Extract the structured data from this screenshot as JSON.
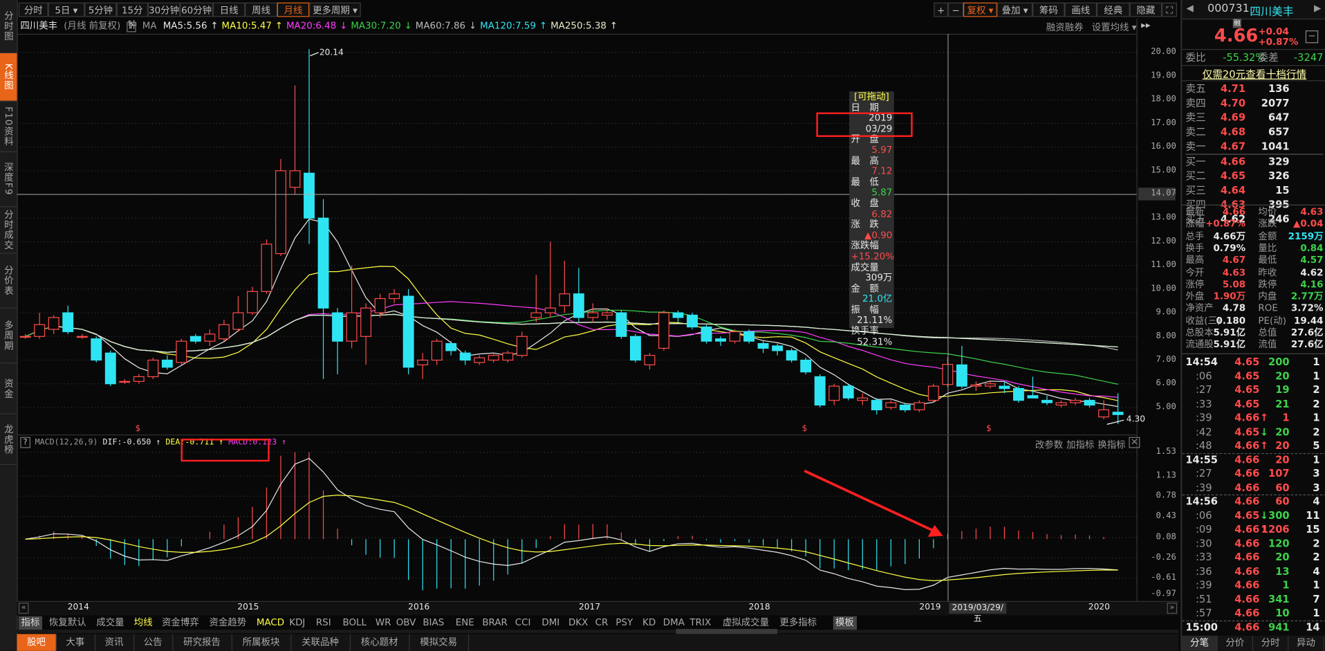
{
  "sidebar": {
    "items": [
      {
        "label": "分时图"
      },
      {
        "label": "K线图",
        "active": true
      },
      {
        "label": "F10资料"
      },
      {
        "label": "深度F9"
      },
      {
        "label": "分时成交"
      },
      {
        "label": "分价表"
      },
      {
        "label": "多周期"
      },
      {
        "label": "资金"
      },
      {
        "label": "龙虎榜"
      }
    ]
  },
  "toolbar": {
    "periods": [
      "分时",
      "5日 ▾",
      "5分钟",
      "15分钟",
      "30分钟",
      "60分钟",
      "日线",
      "周线",
      "月线",
      "更多周期 ▾"
    ],
    "active_period": "月线",
    "right": [
      "+",
      "−",
      "复权 ▾",
      "叠加 ▾",
      "筹码",
      "画线",
      "经典",
      "隐藏 ▸▸",
      "⛶"
    ],
    "active_right": "复权 ▾"
  },
  "infobar": {
    "name": "四川美丰",
    "mode": "(月线 前复权)",
    "help": "?",
    "ma_label": "MA",
    "ma": [
      {
        "text": "MA5:5.56",
        "arrow": "↑",
        "color": "#e8e8e8"
      },
      {
        "text": "MA10:5.47",
        "arrow": "↑",
        "color": "#ffff44"
      },
      {
        "text": "MA20:6.48",
        "arrow": "↓",
        "color": "#ff3cff"
      },
      {
        "text": "MA30:7.20",
        "arrow": "↓",
        "color": "#3cd24a"
      },
      {
        "text": "MA60:7.86",
        "arrow": "↓",
        "color": "#bbbbbb"
      },
      {
        "text": "MA120:7.59",
        "arrow": "↑",
        "color": "#2fe4f2"
      },
      {
        "text": "MA250:5.38",
        "arrow": "↑",
        "color": "#e8e8c8"
      }
    ],
    "margin_trading": "融资融券",
    "set_ma": "设置均线 ▾"
  },
  "chart_data": {
    "type": "candlestick",
    "price_axis": [
      "20.00",
      "19.00",
      "18.00",
      "17.00",
      "16.00",
      "15.00",
      "14.00",
      "13.00",
      "12.00",
      "11.00",
      "10.00",
      "9.00",
      "8.00",
      "7.00",
      "6.00",
      "5.00"
    ],
    "ylim": [
      4.3,
      20.14
    ],
    "crosshair_price": "14.07",
    "max_label": "20.14",
    "min_label": "4.30",
    "dividend_marker": "$",
    "candles": [
      [
        8.0,
        8.1,
        7.9,
        8.0
      ],
      [
        8.0,
        9.0,
        7.9,
        8.5
      ],
      [
        8.3,
        8.9,
        8.1,
        8.8
      ],
      [
        9.0,
        9.3,
        8.1,
        8.2
      ],
      [
        8.0,
        8.1,
        7.9,
        8.0
      ],
      [
        7.9,
        8.0,
        6.9,
        7.0
      ],
      [
        7.3,
        7.4,
        5.9,
        6.0
      ],
      [
        6.1,
        6.2,
        6.0,
        6.1
      ],
      [
        6.1,
        6.4,
        6.0,
        6.3
      ],
      [
        6.3,
        7.1,
        6.2,
        7.0
      ],
      [
        7.0,
        7.2,
        6.6,
        6.7
      ],
      [
        6.9,
        7.9,
        6.8,
        7.8
      ],
      [
        8.0,
        8.1,
        7.7,
        7.8
      ],
      [
        7.8,
        8.3,
        7.6,
        8.1
      ],
      [
        7.9,
        8.7,
        7.8,
        8.5
      ],
      [
        8.3,
        9.7,
        8.2,
        9.0
      ],
      [
        9.0,
        10.1,
        8.9,
        9.9
      ],
      [
        9.9,
        12.1,
        9.8,
        11.9
      ],
      [
        11.5,
        15.5,
        11.4,
        15.0
      ],
      [
        14.3,
        18.6,
        14.0,
        15.0
      ],
      [
        14.9,
        20.14,
        11.9,
        13.0
      ],
      [
        13.0,
        13.8,
        6.2,
        9.2
      ],
      [
        9.0,
        9.2,
        6.4,
        7.8
      ],
      [
        7.8,
        11.0,
        7.5,
        9.0
      ],
      [
        8.0,
        9.4,
        6.8,
        9.2
      ],
      [
        9.0,
        9.8,
        8.8,
        9.6
      ],
      [
        9.6,
        10.0,
        9.4,
        9.8
      ],
      [
        9.7,
        10.0,
        6.4,
        6.7
      ],
      [
        6.8,
        7.3,
        6.2,
        7.0
      ],
      [
        7.0,
        7.9,
        6.8,
        7.8
      ],
      [
        7.7,
        7.8,
        7.2,
        7.4
      ],
      [
        7.3,
        7.4,
        6.8,
        7.0
      ],
      [
        6.9,
        7.2,
        6.8,
        7.1
      ],
      [
        7.0,
        7.3,
        6.9,
        7.2
      ],
      [
        7.0,
        7.4,
        6.9,
        7.3
      ],
      [
        7.2,
        8.2,
        7.1,
        8.0
      ],
      [
        8.8,
        10.6,
        8.6,
        9.0
      ],
      [
        9.0,
        12.0,
        8.8,
        9.2
      ],
      [
        9.3,
        11.2,
        9.0,
        9.8
      ],
      [
        9.8,
        10.9,
        8.6,
        8.8
      ],
      [
        8.8,
        9.4,
        8.6,
        9.0
      ],
      [
        8.9,
        9.2,
        8.7,
        9.0
      ],
      [
        9.0,
        9.1,
        7.9,
        8.0
      ],
      [
        8.0,
        8.1,
        6.9,
        7.0
      ],
      [
        6.8,
        7.3,
        6.6,
        7.2
      ],
      [
        7.5,
        9.1,
        7.4,
        9.0
      ],
      [
        9.0,
        9.1,
        8.6,
        8.8
      ],
      [
        8.9,
        9.0,
        8.3,
        8.4
      ],
      [
        8.4,
        8.5,
        7.7,
        7.8
      ],
      [
        7.9,
        8.0,
        7.6,
        7.8
      ],
      [
        7.8,
        8.3,
        7.7,
        8.2
      ],
      [
        8.2,
        8.3,
        7.7,
        7.8
      ],
      [
        7.7,
        7.8,
        7.3,
        7.5
      ],
      [
        7.6,
        7.7,
        7.2,
        7.4
      ],
      [
        7.4,
        7.5,
        6.9,
        7.0
      ],
      [
        7.0,
        7.1,
        6.4,
        6.5
      ],
      [
        6.3,
        6.4,
        5.0,
        5.1
      ],
      [
        5.3,
        6.0,
        5.1,
        5.9
      ],
      [
        5.9,
        6.0,
        5.3,
        5.4
      ],
      [
        5.3,
        5.6,
        5.1,
        5.4
      ],
      [
        5.3,
        5.4,
        4.7,
        4.9
      ],
      [
        5.0,
        5.3,
        4.9,
        5.2
      ],
      [
        5.1,
        5.2,
        4.8,
        4.9
      ],
      [
        4.9,
        5.3,
        4.8,
        5.2
      ],
      [
        5.3,
        6.0,
        5.2,
        5.9
      ],
      [
        5.97,
        7.12,
        5.87,
        6.82
      ],
      [
        6.8,
        7.6,
        5.8,
        5.9
      ],
      [
        5.9,
        6.1,
        5.7,
        5.95
      ],
      [
        5.9,
        6.1,
        5.8,
        6.0
      ],
      [
        5.9,
        6.1,
        5.6,
        5.8
      ],
      [
        5.8,
        5.9,
        5.2,
        5.3
      ],
      [
        5.5,
        6.3,
        5.4,
        5.4
      ],
      [
        5.3,
        5.5,
        5.1,
        5.2
      ],
      [
        5.1,
        5.3,
        5.0,
        5.2
      ],
      [
        5.2,
        5.4,
        5.1,
        5.3
      ],
      [
        5.3,
        5.4,
        5.0,
        5.1
      ],
      [
        4.6,
        5.3,
        4.5,
        4.9
      ],
      [
        4.8,
        5.6,
        4.3,
        4.7
      ]
    ],
    "x_ticks": [
      "2014",
      "2015",
      "2016",
      "2017",
      "2018",
      "2019",
      "2020"
    ],
    "crosshair_date": "2019/03/29/五"
  },
  "tooltip": {
    "drag": "[可拖动]",
    "rows": [
      {
        "label": "日　期",
        "value": "2019\n03/29",
        "color": "#e8e8e8"
      },
      {
        "label": "开　盘",
        "value": "5.97",
        "color": "#ff4b4b"
      },
      {
        "label": "最　高",
        "value": "7.12",
        "color": "#ff4b4b"
      },
      {
        "label": "最　低",
        "value": "5.87",
        "color": "#3cd24a"
      },
      {
        "label": "收　盘",
        "value": "6.82",
        "color": "#ff4b4b"
      },
      {
        "label": "涨　跌",
        "value": "▲0.90",
        "color": "#ff4b4b"
      },
      {
        "label": "涨跌幅",
        "value": "+15.20%",
        "color": "#ff4b4b"
      },
      {
        "label": "成交量",
        "value": "309万",
        "color": "#e8e8e8"
      },
      {
        "label": "金　额",
        "value": "21.0亿",
        "color": "#2fe4f2"
      },
      {
        "label": "振　幅",
        "value": "21.11%",
        "color": "#e8e8e8"
      },
      {
        "label": "换手率",
        "value": "52.31%",
        "color": "#e8e8e8"
      }
    ]
  },
  "macd": {
    "help": "?",
    "name": "MACD(12,26,9)",
    "dif": "DIF:-0.650 ↑",
    "dea": "DEA:-0.711 ↑",
    "macd": "MACD:0.123 ↑",
    "actions": [
      "改参数",
      "加指标",
      "换指标"
    ],
    "close": "×",
    "axis": [
      "1.53",
      "1.13",
      "0.78",
      "0.43",
      "0.08",
      "-0.26",
      "-0.61",
      "-0.97"
    ],
    "ylim": [
      -0.97,
      1.53
    ]
  },
  "indicators": {
    "items": [
      "指标",
      "恢复默认",
      "成交量",
      "均线",
      "资金博弈",
      "资金趋势",
      "MACD",
      "KDJ",
      "RSI",
      "BOLL",
      "WR",
      "OBV",
      "BIAS",
      "ENE",
      "BRAR",
      "CCI",
      "DMI",
      "DKX",
      "CR",
      "PSY",
      "KD",
      "DMA",
      "TRIX",
      "虚拟成交量",
      "更多指标",
      "模板"
    ],
    "highlight": [
      "均线",
      "MACD"
    ]
  },
  "bottom_tabs": [
    "股吧",
    "大事",
    "资讯",
    "公告",
    "研究报告",
    "所属板块",
    "关联品种",
    "核心题材",
    "模拟交易"
  ],
  "quote": {
    "code": "000731",
    "name": "四川美丰",
    "badge": "融",
    "price": "4.66",
    "change": "+0.04",
    "pct": "+0.87%",
    "weibi_label": "委比",
    "weibi": "-55.32%",
    "weicha_label": "委差",
    "weicha": "-3247",
    "promo": "仅需20元查看十档行情",
    "asks": [
      {
        "label": "卖五",
        "price": "4.71",
        "vol": "136"
      },
      {
        "label": "卖四",
        "price": "4.70",
        "vol": "2077"
      },
      {
        "label": "卖三",
        "price": "4.69",
        "vol": "647"
      },
      {
        "label": "卖二",
        "price": "4.68",
        "vol": "657"
      },
      {
        "label": "卖一",
        "price": "4.67",
        "vol": "1041"
      }
    ],
    "bids": [
      {
        "label": "买一",
        "price": "4.66",
        "vol": "329",
        "color": "#ff4b4b"
      },
      {
        "label": "买二",
        "price": "4.65",
        "vol": "326",
        "color": "#ff4b4b"
      },
      {
        "label": "买三",
        "price": "4.64",
        "vol": "15",
        "color": "#ff4b4b"
      },
      {
        "label": "买四",
        "price": "4.63",
        "vol": "395",
        "color": "#ff4b4b"
      },
      {
        "label": "买五",
        "price": "4.62",
        "vol": "246",
        "color": "#e8e8e8"
      }
    ],
    "stats": [
      [
        "最新",
        "4.66",
        "#ff4b4b",
        "均价",
        "4.63",
        "#ff4b4b"
      ],
      [
        "涨幅",
        "+0.87%",
        "#ff4b4b",
        "涨跌",
        "▲0.04",
        "#ff4b4b"
      ],
      [
        "总手",
        "4.66万",
        "#e8e8e8",
        "金额",
        "2159万",
        "#2fe4f2"
      ],
      [
        "换手",
        "0.79%",
        "#e8e8e8",
        "量比",
        "0.84",
        "#3cd24a"
      ],
      [
        "最高",
        "4.67",
        "#ff4b4b",
        "最低",
        "4.57",
        "#3cd24a"
      ],
      [
        "今开",
        "4.63",
        "#ff4b4b",
        "昨收",
        "4.62",
        "#e8e8e8"
      ],
      [
        "涨停",
        "5.08",
        "#ff4b4b",
        "跌停",
        "4.16",
        "#3cd24a"
      ],
      [
        "外盘",
        "1.90万",
        "#ff4b4b",
        "内盘",
        "2.77万",
        "#3cd24a"
      ],
      [
        "净资产",
        "4.78",
        "#e8e8e8",
        "ROE",
        "3.72%",
        "#e8e8e8"
      ],
      [
        "收益(三)",
        "0.180",
        "#e8e8e8",
        "PE(动)",
        "19.44",
        "#e8e8e8"
      ],
      [
        "总股本",
        "5.91亿",
        "#e8e8e8",
        "总值",
        "27.6亿",
        "#e8e8e8"
      ],
      [
        "流通股",
        "5.91亿",
        "#e8e8e8",
        "流值",
        "27.6亿",
        "#e8e8e8"
      ]
    ],
    "ticks": [
      [
        "14:54",
        "4.65",
        "",
        "200",
        "g",
        "1"
      ],
      [
        ":06",
        "4.65",
        "",
        "20",
        "g",
        "1"
      ],
      [
        ":27",
        "4.65",
        "",
        "19",
        "g",
        "2"
      ],
      [
        ":33",
        "4.65",
        "",
        "21",
        "g",
        "2"
      ],
      [
        ":39",
        "4.66",
        "↑",
        "1",
        "r",
        "1"
      ],
      [
        ":42",
        "4.65",
        "↓",
        "20",
        "g",
        "2"
      ],
      [
        ":48",
        "4.66",
        "↑",
        "20",
        "r",
        "5"
      ],
      [
        "14:55",
        "4.66",
        "",
        "20",
        "r",
        "1"
      ],
      [
        ":27",
        "4.66",
        "",
        "107",
        "r",
        "3"
      ],
      [
        ":39",
        "4.66",
        "",
        "60",
        "r",
        "3"
      ],
      [
        "14:56",
        "4.66",
        "",
        "60",
        "r",
        "4"
      ],
      [
        ":06",
        "4.65",
        "↓",
        "300",
        "g",
        "11"
      ],
      [
        ":09",
        "4.66",
        "↑",
        "1206",
        "r",
        "15"
      ],
      [
        ":30",
        "4.66",
        "",
        "120",
        "g",
        "2"
      ],
      [
        ":33",
        "4.66",
        "",
        "20",
        "g",
        "2"
      ],
      [
        ":36",
        "4.66",
        "",
        "13",
        "g",
        "4"
      ],
      [
        ":39",
        "4.66",
        "",
        "1",
        "g",
        "1"
      ],
      [
        ":51",
        "4.66",
        "",
        "341",
        "g",
        "7"
      ],
      [
        ":57",
        "4.66",
        "",
        "10",
        "g",
        "1"
      ],
      [
        "15:00",
        "4.66",
        "",
        "941",
        "g",
        "14"
      ]
    ],
    "tabs": [
      "分笔",
      "分价",
      "分时",
      "异动"
    ],
    "active_tab": "分笔"
  },
  "colors": {
    "up": "#ff4b4b",
    "down": "#2fe4f2",
    "accent": "#e8651a",
    "annotation": "#ff2020"
  }
}
